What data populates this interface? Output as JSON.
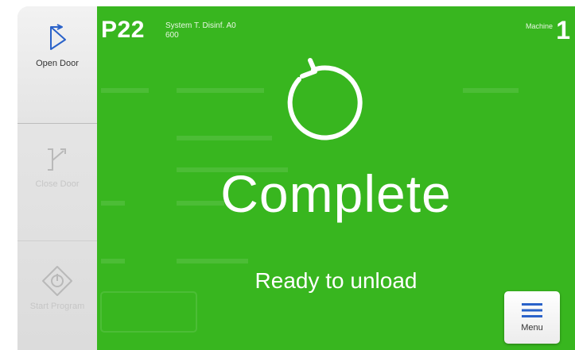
{
  "sidebar": {
    "open_door": {
      "label": "Open Door",
      "icon": "open-door-icon",
      "enabled": true
    },
    "close_door": {
      "label": "Close Door",
      "icon": "close-door-icon",
      "enabled": false
    },
    "start_program": {
      "label": "Start Program",
      "icon": "start-program-icon",
      "enabled": false
    }
  },
  "header": {
    "program_code": "P22",
    "program_name_line1": "System T. Disinf. A0",
    "program_name_line2": "600",
    "machine_label": "Machine",
    "machine_number": "1"
  },
  "status": {
    "icon": "cycle-complete-icon",
    "title": "Complete",
    "subtitle": "Ready to unload",
    "color": "#38b61f"
  },
  "menu": {
    "label": "Menu",
    "icon": "hamburger-menu-icon",
    "icon_color": "#2a62c9"
  },
  "colors": {
    "accent_blue": "#2a62c9",
    "status_green": "#38b61f",
    "sidebar_gray": "#e4e4e4"
  }
}
